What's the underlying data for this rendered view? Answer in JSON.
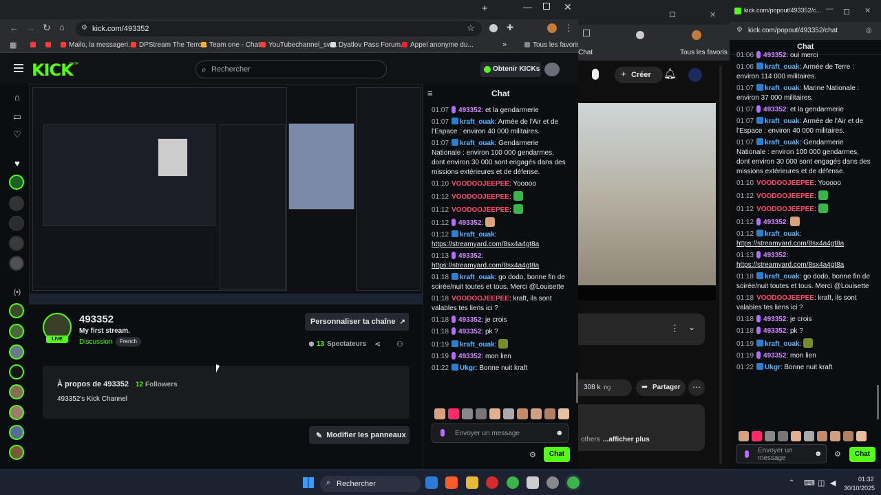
{
  "left_browser": {
    "url": "kick.com/493352",
    "bookmarks": [
      "",
      "",
      "Mailo, la messageri...",
      "DPStream The Terro...",
      "Team one - Chat",
      "YouTubechannel_sw...",
      "Dyatlov Pass Forum...",
      "Appel anonyme du..."
    ],
    "bookmark_folder": "Tous les favoris",
    "kick": {
      "logo": "KICK",
      "beta": "BETA",
      "search_placeholder": "Rechercher",
      "obtain": "Obtenir KICKs"
    },
    "channel": {
      "name": "493352",
      "title": "My first stream.",
      "category": "Discussion",
      "tag": "French",
      "live": "LIVE",
      "customize": "Personnaliser ta chaîne",
      "viewers": "13",
      "viewers_label": "Spectateurs"
    },
    "about": {
      "title": "À propos de 493352",
      "followers_count": "12",
      "followers_label": "Followers",
      "desc": "493352's Kick Channel"
    },
    "edit_panels": "Modifier les panneaux",
    "chat": {
      "header": "Chat",
      "placeholder": "Envoyer un message",
      "send": "Chat",
      "messages": [
        {
          "t": "01:07",
          "u": "493352",
          "c": "u3",
          "icon": "mic",
          "m": ": et la gendarmerie"
        },
        {
          "t": "01:07",
          "u": "kraft_ouak",
          "c": "u1",
          "icon": "badge",
          "m": ": Armée de l'Air et de l'Espace : environ 40 000 militaires."
        },
        {
          "t": "01:07",
          "u": "kraft_ouak",
          "c": "u1",
          "icon": "badge",
          "m": ": Gendarmerie Nationale : environ 100 000 gendarmes, dont environ 30 000 sont engagés dans des missions extérieures et de défense."
        },
        {
          "t": "01:10",
          "u": "VOODOOJEEPEE",
          "c": "u2",
          "icon": "",
          "m": ": Yooooo"
        },
        {
          "t": "01:12",
          "u": "VOODOOJEEPEE",
          "c": "u2",
          "icon": "",
          "m": ":",
          "emo": "#3ab54a"
        },
        {
          "t": "01:12",
          "u": "VOODOOJEEPEE",
          "c": "u2",
          "icon": "",
          "m": ":",
          "emo": "#3ab54a"
        },
        {
          "t": "01:12",
          "u": "493352",
          "c": "u3",
          "icon": "mic",
          "m": ":",
          "emo": "#d9a27a"
        },
        {
          "t": "01:12",
          "u": "kraft_ouak",
          "c": "u1",
          "icon": "badge",
          "m": ":",
          "link": "https://streamyard.com/8sx4a4gt8a"
        },
        {
          "t": "01:13",
          "u": "493352",
          "c": "u3",
          "icon": "mic",
          "m": ":",
          "link": "https://streamyard.com/8sx4a4gt8a"
        },
        {
          "t": "01:18",
          "u": "kraft_ouak",
          "c": "u1",
          "icon": "badge",
          "m": ": go dodo, bonne fin de soirée/nuit toutes et tous. Merci @Louisette"
        },
        {
          "t": "01:18",
          "u": "VOODOOJEEPEE",
          "c": "u2",
          "icon": "",
          "m": ": kraft, ils sont valables tes liens ici ?"
        },
        {
          "t": "01:18",
          "u": "493352",
          "c": "u3",
          "icon": "mic",
          "m": ": je crois"
        },
        {
          "t": "01:18",
          "u": "493352",
          "c": "u3",
          "icon": "mic",
          "m": ": pk ?"
        },
        {
          "t": "01:19",
          "u": "kraft_ouak",
          "c": "u1",
          "icon": "badge",
          "m": ":",
          "emo": "#7a8a2a"
        },
        {
          "t": "01:19",
          "u": "493352",
          "c": "u3",
          "icon": "mic",
          "m": ": mon lien"
        },
        {
          "t": "01:22",
          "u": "Ukgr",
          "c": "u4",
          "icon": "badge",
          "m": ": Bonne nuit kraft"
        }
      ]
    }
  },
  "middle_window": {
    "create": "Créer",
    "likes": "308 k",
    "share": "Partager",
    "chat_label": "Chat",
    "favorites": "Tous les favoris",
    "others": "others",
    "show_more": "...afficher plus"
  },
  "right_window": {
    "tab_title": "kick.com/popout/493352/c...",
    "url": "kick.com/popout/493352/chat",
    "header": "Chat",
    "placeholder": "Envoyer un message",
    "send": "Chat",
    "top_partial": "oui merci",
    "messages": [
      {
        "t": "01:06",
        "u": "493352",
        "c": "u3",
        "icon": "mic",
        "m": ": oui merci"
      },
      {
        "t": "01:06",
        "u": "kraft_ouak",
        "c": "u1",
        "icon": "badge",
        "m": ": Armée de Terre : environ 114 000 militaires."
      },
      {
        "t": "01:07",
        "u": "kraft_ouak",
        "c": "u1",
        "icon": "badge",
        "m": ": Marine Nationale : environ 37 000 militaires."
      },
      {
        "t": "01:07",
        "u": "493352",
        "c": "u3",
        "icon": "mic",
        "m": ": et la gendarmerie"
      },
      {
        "t": "01:07",
        "u": "kraft_ouak",
        "c": "u1",
        "icon": "badge",
        "m": ": Armée de l'Air et de l'Espace : environ 40 000 militaires."
      },
      {
        "t": "01:07",
        "u": "kraft_ouak",
        "c": "u1",
        "icon": "badge",
        "m": ": Gendarmerie Nationale : environ 100 000 gendarmes, dont environ 30 000 sont engagés dans des missions extérieures et de défense."
      },
      {
        "t": "01:10",
        "u": "VOODOOJEEPEE",
        "c": "u2",
        "icon": "",
        "m": ": Yooooo"
      },
      {
        "t": "01:12",
        "u": "VOODOOJEEPEE",
        "c": "u2",
        "icon": "",
        "m": ":",
        "emo": "#3ab54a"
      },
      {
        "t": "01:12",
        "u": "VOODOOJEEPEE",
        "c": "u2",
        "icon": "",
        "m": ":",
        "emo": "#3ab54a"
      },
      {
        "t": "01:12",
        "u": "493352",
        "c": "u3",
        "icon": "mic",
        "m": ":",
        "emo": "#d9a27a"
      },
      {
        "t": "01:12",
        "u": "kraft_ouak",
        "c": "u1",
        "icon": "badge",
        "m": ":",
        "link": "https://streamyard.com/8sx4a4gt8a"
      },
      {
        "t": "01:13",
        "u": "493352",
        "c": "u3",
        "icon": "mic",
        "m": ":",
        "link": "https://streamyard.com/8sx4a4gt8a"
      },
      {
        "t": "01:18",
        "u": "kraft_ouak",
        "c": "u1",
        "icon": "badge",
        "m": ": go dodo, bonne fin de soirée/nuit toutes et tous. Merci @Louisette"
      },
      {
        "t": "01:18",
        "u": "VOODOOJEEPEE",
        "c": "u2",
        "icon": "",
        "m": ": kraft, ils sont valables tes liens ici ?"
      },
      {
        "t": "01:18",
        "u": "493352",
        "c": "u3",
        "icon": "mic",
        "m": ": je crois"
      },
      {
        "t": "01:18",
        "u": "493352",
        "c": "u3",
        "icon": "mic",
        "m": ": pk ?"
      },
      {
        "t": "01:19",
        "u": "kraft_ouak",
        "c": "u1",
        "icon": "badge",
        "m": ":",
        "emo": "#7a8a2a"
      },
      {
        "t": "01:19",
        "u": "493352",
        "c": "u3",
        "icon": "mic",
        "m": ": mon lien"
      },
      {
        "t": "01:22",
        "u": "Ukgr",
        "c": "u4",
        "icon": "badge",
        "m": ": Bonne nuit kraft"
      }
    ]
  },
  "taskbar": {
    "search": "Rechercher",
    "time": "01:32",
    "date": "30/10/2025"
  },
  "colors": {
    "kick_green": "#53fc18",
    "bg": "#0b0e11",
    "panel": "#191b1f"
  }
}
